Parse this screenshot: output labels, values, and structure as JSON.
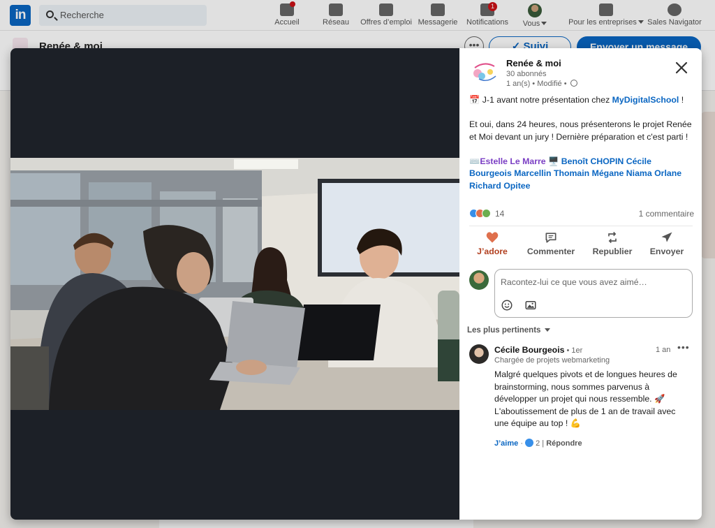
{
  "nav": {
    "search_placeholder": "Recherche",
    "items": [
      {
        "label": "Accueil",
        "badge": ""
      },
      {
        "label": "Réseau",
        "badge": ""
      },
      {
        "label": "Offres d’emploi",
        "badge": ""
      },
      {
        "label": "Messagerie",
        "badge": ""
      },
      {
        "label": "Notifications",
        "badge": "1"
      },
      {
        "label": "Vous"
      },
      {
        "label": "Pour les entreprises"
      },
      {
        "label": "Sales Navigator"
      }
    ]
  },
  "page_header": {
    "title": "Renée & moi",
    "follow_label": "Suivi",
    "message_label": "Envoyer un message"
  },
  "post": {
    "author_name": "Renée & moi",
    "followers": "30 abonnés",
    "time": "1 an(s) • Modifié •",
    "line1_prefix": "📅 J-1 avant notre présentation chez ",
    "line1_mention": "MyDigitalSchool",
    "line1_suffix": " !",
    "paragraph2": "Et oui, dans 24 heures, nous présenterons le projet Renée et Moi devant un jury ! Dernière préparation et c'est parti !",
    "tag_prefix": "⌨️",
    "tag_purple": "Estelle Le Marre",
    "tag_middle": " 🖥️ ",
    "tag_blue": "Benoît CHOPIN Cécile Bourgeois Marcellin Thomain Mégane Niama Orlane Richard Opitee",
    "reactions_count": "14",
    "comments_count": "1 commentaire"
  },
  "actions": {
    "like": "J’adore",
    "comment": "Commenter",
    "repost": "Republier",
    "send": "Envoyer"
  },
  "comment_input": {
    "placeholder": "Racontez-lui ce que vous avez aimé…"
  },
  "sort_label": "Les plus pertinents",
  "comment": {
    "author": "Cécile Bourgeois",
    "degree": " • 1er",
    "headline": "Chargée de projets webmarketing",
    "time": "1 an",
    "more": "•••",
    "text": "Malgré quelques pivots et de longues heures de brainstorming, nous sommes parvenus à développer un projet qui nous ressemble. 🚀 L'aboutissement de plus de 1 an de travail avec une équipe au top ! 💪",
    "like_label": "J’aime",
    "like_count": "2",
    "reply_label": "Répondre"
  },
  "colors": {
    "linkedin_blue": "#0a66c2",
    "love_red": "#b24020",
    "mention_purple": "#7b3fc4"
  }
}
